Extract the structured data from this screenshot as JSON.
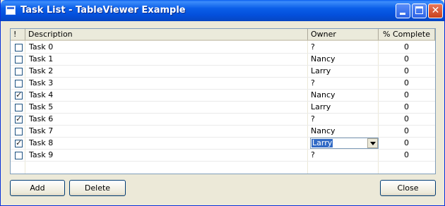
{
  "window": {
    "title": "Task List - TableViewer Example"
  },
  "table": {
    "headers": {
      "completed": "!",
      "description": "Description",
      "owner": "Owner",
      "percent": "% Complete"
    },
    "rows": [
      {
        "checked": false,
        "description": "Task 0",
        "owner": "?",
        "percent": "0"
      },
      {
        "checked": false,
        "description": "Task 1",
        "owner": "Nancy",
        "percent": "0"
      },
      {
        "checked": false,
        "description": "Task 2",
        "owner": "Larry",
        "percent": "0"
      },
      {
        "checked": false,
        "description": "Task 3",
        "owner": "?",
        "percent": "0"
      },
      {
        "checked": true,
        "description": "Task 4",
        "owner": "Nancy",
        "percent": "0"
      },
      {
        "checked": false,
        "description": "Task 5",
        "owner": "Larry",
        "percent": "0"
      },
      {
        "checked": true,
        "description": "Task 6",
        "owner": "?",
        "percent": "0"
      },
      {
        "checked": false,
        "description": "Task 7",
        "owner": "Nancy",
        "percent": "0"
      },
      {
        "checked": true,
        "description": "Task 8",
        "owner": "Larry",
        "percent": "0",
        "editing_owner": true
      },
      {
        "checked": false,
        "description": "Task 9",
        "owner": "?",
        "percent": "0"
      }
    ]
  },
  "buttons": {
    "add": "Add",
    "delete": "Delete",
    "close": "Close"
  },
  "icons": {
    "check": "✓",
    "close": "✕"
  }
}
